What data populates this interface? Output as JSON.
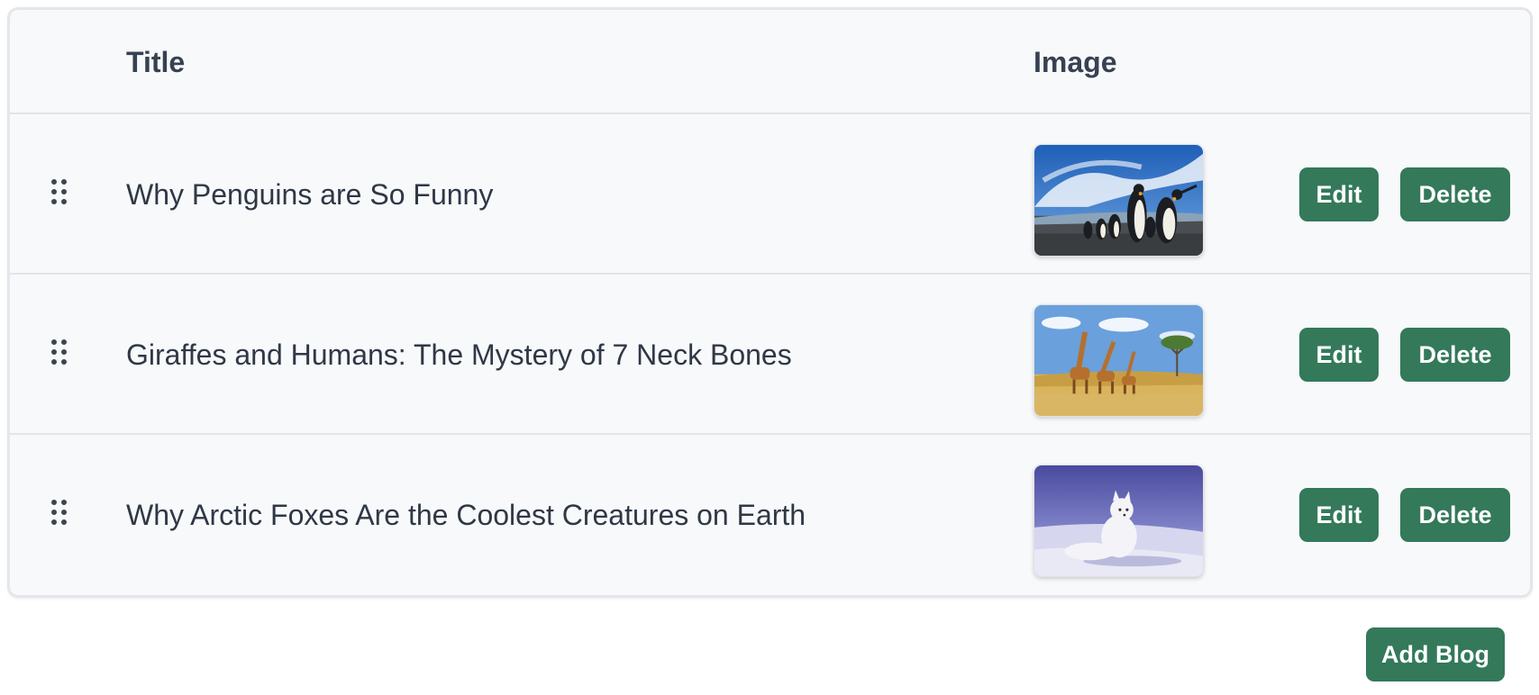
{
  "table": {
    "headers": {
      "title": "Title",
      "image": "Image"
    },
    "rows": [
      {
        "title": "Why Penguins are So Funny",
        "image_subject": "penguins",
        "edit_label": "Edit",
        "delete_label": "Delete"
      },
      {
        "title": "Giraffes and Humans: The Mystery of 7 Neck Bones",
        "image_subject": "giraffes",
        "edit_label": "Edit",
        "delete_label": "Delete"
      },
      {
        "title": "Why Arctic Foxes Are the Coolest Creatures on Earth",
        "image_subject": "arctic-fox",
        "edit_label": "Edit",
        "delete_label": "Delete"
      }
    ]
  },
  "actions": {
    "add_blog_label": "Add Blog"
  },
  "icons": {
    "drag": "drag-handle-icon"
  },
  "colors": {
    "accent": "#33795a",
    "card_background": "#f8f9fb",
    "text": "#374151",
    "border": "#e2e5e9"
  }
}
